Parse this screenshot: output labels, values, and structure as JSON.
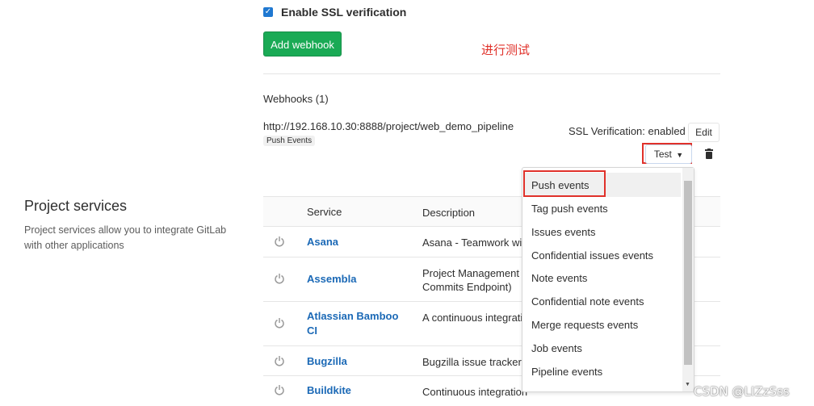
{
  "ssl": {
    "checked": true,
    "label": "Enable SSL verification"
  },
  "add_webhook_label": "Add webhook",
  "annotation": "进行测试",
  "webhooks": {
    "title": "Webhooks (1)",
    "url": "http://192.168.10.30:8888/project/web_demo_pipeline",
    "badge": "Push Events",
    "ssl_status": "SSL Verification: enabled",
    "edit_label": "Edit",
    "test_label": "Test"
  },
  "project_services": {
    "title": "Project services",
    "description": "Project services allow you to integrate GitLab with other applications"
  },
  "table": {
    "headers": {
      "service": "Service",
      "description": "Description"
    },
    "rows": [
      {
        "service": "Asana",
        "description": "Asana - Teamwork wit"
      },
      {
        "service": "Assembla",
        "description": "Project Management S",
        "description2": "Commits Endpoint)"
      },
      {
        "service": "Atlassian Bamboo",
        "service2": "CI",
        "description": "A continuous integrati"
      },
      {
        "service": "Bugzilla",
        "description": "Bugzilla issue tracker"
      },
      {
        "service": "Buildkite",
        "description": "Continuous integration"
      }
    ]
  },
  "dropdown": {
    "items": [
      "Push events",
      "Tag push events",
      "Issues events",
      "Confidential issues events",
      "Note events",
      "Confidential note events",
      "Merge requests events",
      "Job events",
      "Pipeline events"
    ]
  },
  "watermark": "CSDN @LIZzSss",
  "colors": {
    "green": "#1aaa55",
    "link": "#1b69b6",
    "annotation_red": "#e0312a"
  }
}
